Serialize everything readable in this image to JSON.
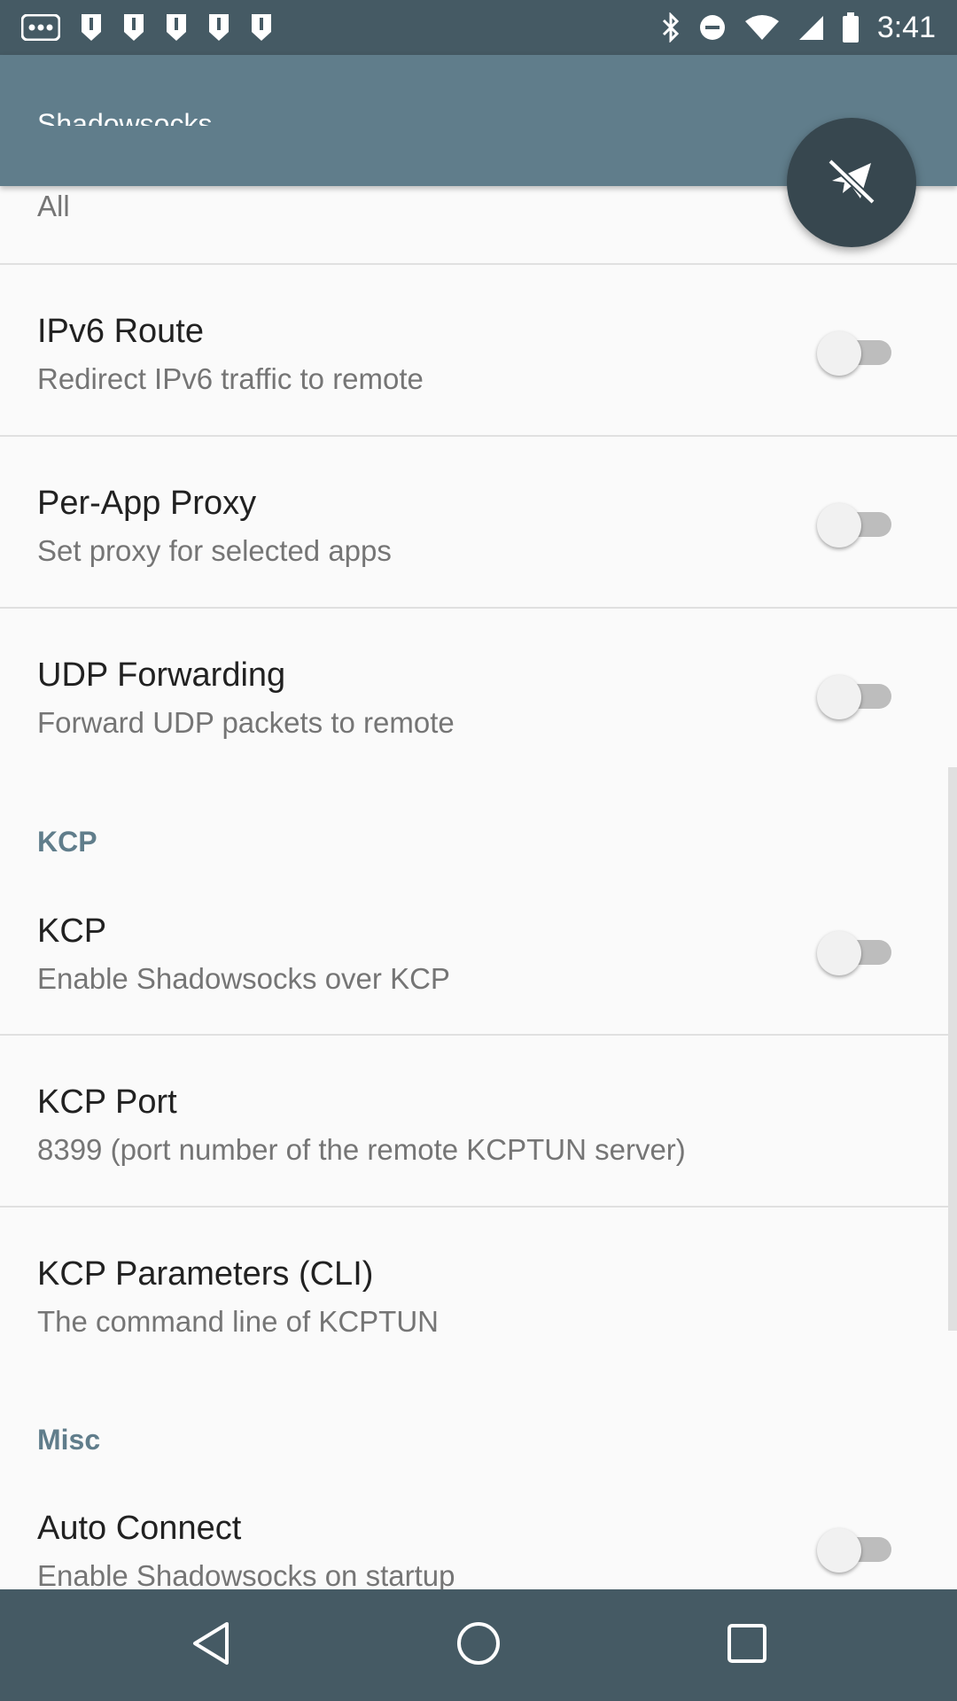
{
  "status_bar": {
    "time": "3:41",
    "left_icons": [
      "more-horiz-icon",
      "notification-icon",
      "notification-icon",
      "notification-icon",
      "notification-icon",
      "notification-icon"
    ],
    "right_icons": [
      "bluetooth-icon",
      "minus-circle-icon",
      "wifi-icon",
      "signal-icon",
      "battery-icon"
    ]
  },
  "toolbar": {
    "title": "Shadowsocks"
  },
  "fab": {
    "icon": "airplane-off-icon"
  },
  "prefs": {
    "route": {
      "summary": "All"
    },
    "ipv6": {
      "title": "IPv6 Route",
      "summary": "Redirect IPv6 traffic to remote",
      "checked": false
    },
    "per_app": {
      "title": "Per-App Proxy",
      "summary": "Set proxy for selected apps",
      "checked": false
    },
    "udp": {
      "title": "UDP Forwarding",
      "summary": "Forward UDP packets to remote",
      "checked": false
    },
    "kcp_category": "KCP",
    "kcp": {
      "title": "KCP",
      "summary": "Enable Shadowsocks over KCP",
      "checked": false
    },
    "kcp_port": {
      "title": "KCP Port",
      "summary": "8399 (port number of the remote KCPTUN server)"
    },
    "kcp_cli": {
      "title": "KCP Parameters (CLI)",
      "summary": "The command line of KCPTUN"
    },
    "misc_category": "Misc",
    "auto_connect": {
      "title": "Auto Connect",
      "summary": "Enable Shadowsocks on startup",
      "checked": false
    }
  },
  "nav": {
    "back": "back-icon",
    "home": "home-icon",
    "recents": "recents-icon"
  },
  "colors": {
    "status_bar": "#455a64",
    "toolbar": "#607d8b",
    "fab": "#37474f",
    "category": "#607d8b"
  }
}
